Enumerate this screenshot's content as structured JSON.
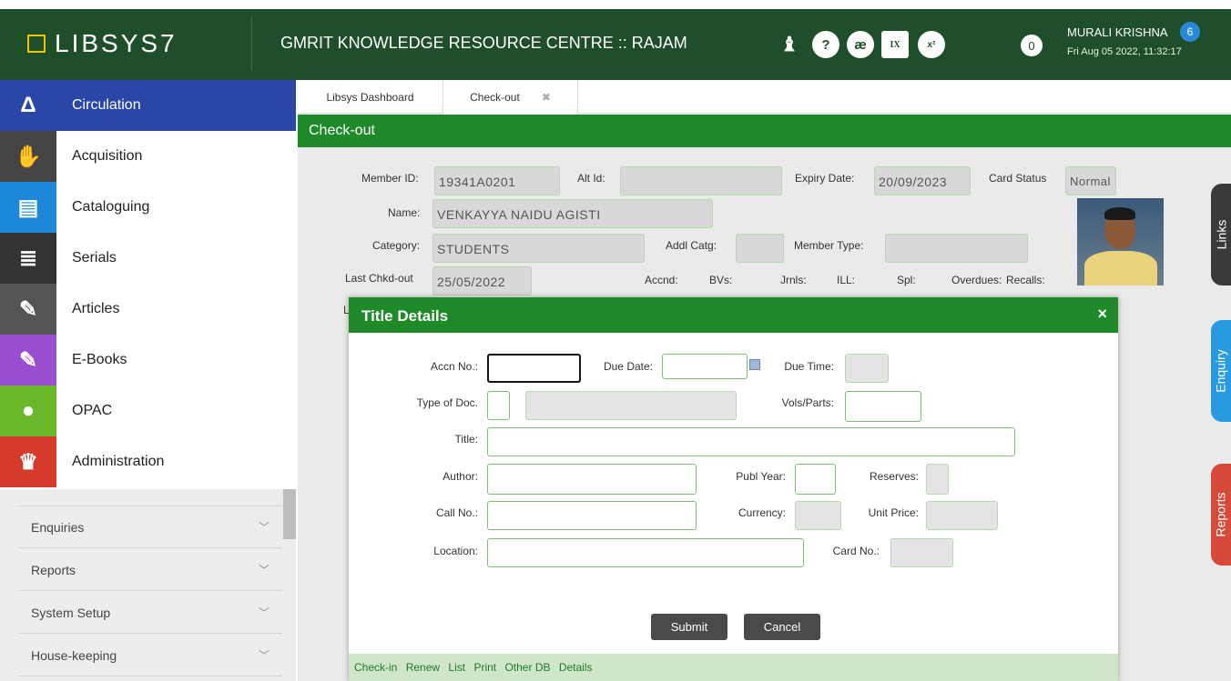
{
  "header": {
    "logo_text": "LIBSYS7",
    "title": "GMRIT KNOWLEDGE RESOURCE CENTRE :: RAJAM",
    "notification_count": "0",
    "user_name": "MURALI KRISHNA",
    "user_datetime": "Fri Aug 05 2022, 11:32:17",
    "user_badge": "6",
    "icons": [
      "user-settings-icon",
      "help-icon",
      "special-characters-icon",
      "roman-numerals-icon",
      "superscript-icon"
    ]
  },
  "modules": [
    {
      "label": "Circulation",
      "icon": "delta-icon",
      "color": "#2a47a8",
      "active": true
    },
    {
      "label": "Acquisition",
      "icon": "handshake-icon",
      "color": "#444444"
    },
    {
      "label": "Cataloguing",
      "icon": "catalog-cards-icon",
      "color": "#1e88d8"
    },
    {
      "label": "Serials",
      "icon": "book-stack-icon",
      "color": "#333333"
    },
    {
      "label": "Articles",
      "icon": "edit-icon",
      "color": "#555555"
    },
    {
      "label": "E-Books",
      "icon": "edit-icon",
      "color": "#9a4fd0"
    },
    {
      "label": "OPAC",
      "icon": "opac-circles-icon",
      "color": "#6ab82a"
    },
    {
      "label": "Administration",
      "icon": "crown-icon",
      "color": "#d63a2a"
    }
  ],
  "submenu": [
    {
      "label": "Enquiries"
    },
    {
      "label": "Reports"
    },
    {
      "label": "System Setup"
    },
    {
      "label": "House-keeping"
    }
  ],
  "tabs": {
    "dashboard": "Libsys Dashboard",
    "checkout": "Check-out"
  },
  "checkout": {
    "heading": "Check-out",
    "member_id_label": "Member ID:",
    "member_id": "19341A0201",
    "alt_id_label": "Alt Id:",
    "alt_id": "",
    "expiry_label": "Expiry Date:",
    "expiry": "20/09/2023",
    "card_status_label": "Card Status",
    "card_status": "Normal",
    "name_label": "Name:",
    "name": "VENKAYYA NAIDU AGISTI",
    "category_label": "Category:",
    "category": "STUDENTS",
    "addl_catg_label": "Addl Catg:",
    "member_type_label": "Member Type:",
    "last_chkd_label": "Last Chkd-out",
    "last_chkd": "25/05/2022",
    "accnd_label": "Accnd:",
    "bvs_label": "BVs:",
    "jrnls_label": "Jrnls:",
    "ill_label": "ILL:",
    "spl_label": "Spl:",
    "overdues_label": "Overdues:",
    "recalls_label": "Recalls:",
    "hidden_label_stub": "L"
  },
  "side_tabs": [
    {
      "label": "Links",
      "color": "#3a3a3a"
    },
    {
      "label": "Enquiry",
      "color": "#2a9ae0"
    },
    {
      "label": "Reports",
      "color": "#d64a3a"
    }
  ],
  "modal": {
    "title": "Title Details",
    "close": "×",
    "accn_label": "Accn No.:",
    "due_date_label": "Due Date:",
    "due_time_label": "Due Time:",
    "type_doc_label": "Type of Doc.",
    "vols_label": "Vols/Parts:",
    "title_label": "Title:",
    "author_label": "Author:",
    "publ_year_label": "Publ Year:",
    "reserves_label": "Reserves:",
    "call_no_label": "Call No.:",
    "currency_label": "Currency:",
    "unit_price_label": "Unit Price:",
    "location_label": "Location:",
    "card_no_label": "Card No.:",
    "submit": "Submit",
    "cancel": "Cancel",
    "footer_links": [
      "Check-in",
      "Renew",
      "List",
      "Print",
      "Other DB",
      "Details"
    ]
  }
}
